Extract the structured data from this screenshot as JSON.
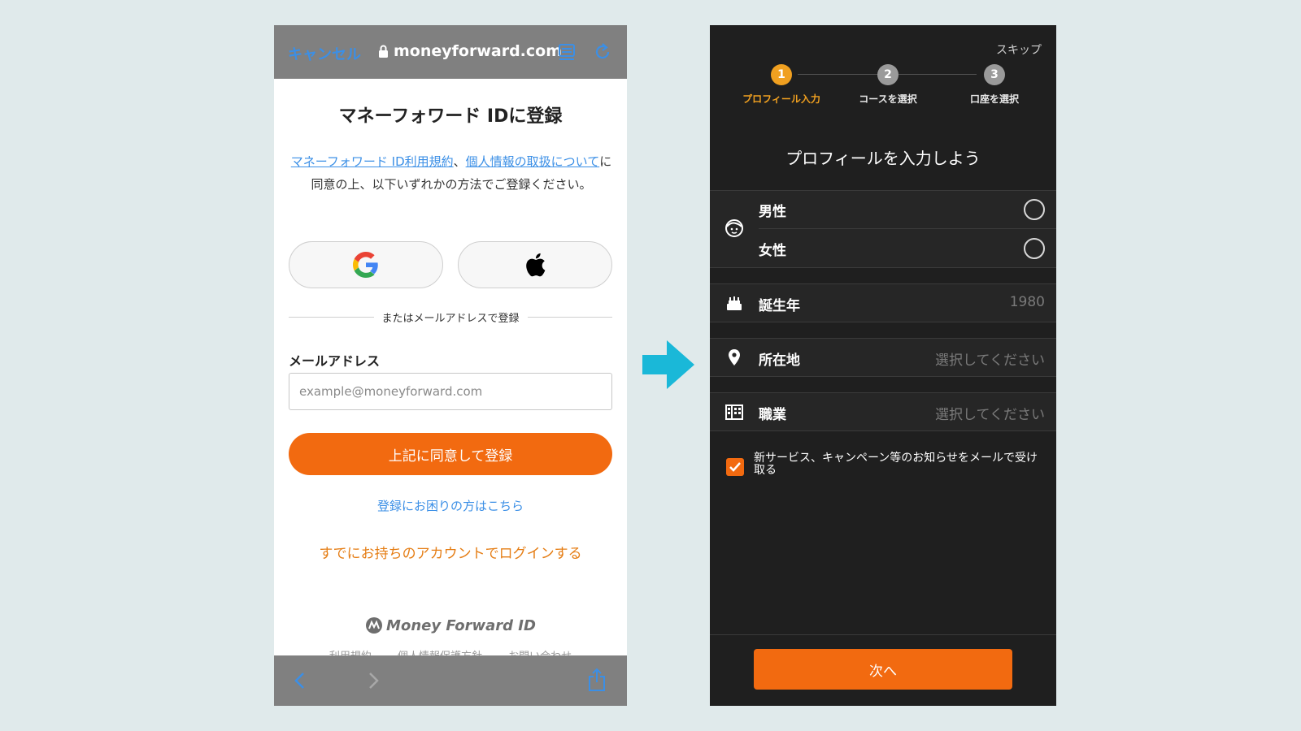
{
  "left": {
    "browser": {
      "cancel_label": "キャンセル",
      "url": "moneyforward.com"
    },
    "title": "マネーフォワード IDに登録",
    "terms": {
      "link1": "マネーフォワード ID利用規約",
      "separator": "、",
      "link2": "個人情報の取扱について",
      "suffix": "に同意の上、以下いずれかの方法でご登録ください。"
    },
    "divider_text": "またはメールアドレスで登録",
    "email": {
      "label": "メールアドレス",
      "placeholder": "example@moneyforward.com"
    },
    "register_button": "上記に同意して登録",
    "help_link": "登録にお困りの方はこちら",
    "login_link": "すでにお持ちのアカウントでログインする",
    "logo_text": "Money Forward ID",
    "footer_links": [
      "利用規約",
      "個人情報保護方針",
      "お問い合わせ"
    ]
  },
  "right": {
    "skip_label": "スキップ",
    "steps": [
      {
        "num": "1",
        "label": "プロフィール入力",
        "active": true
      },
      {
        "num": "2",
        "label": "コースを選択",
        "active": false
      },
      {
        "num": "3",
        "label": "口座を選択",
        "active": false
      }
    ],
    "title": "プロフィールを入力しよう",
    "gender": {
      "male": "男性",
      "female": "女性"
    },
    "birth_year": {
      "label": "誕生年",
      "value": "1980"
    },
    "location": {
      "label": "所在地",
      "value": "選択してください"
    },
    "occupation": {
      "label": "職業",
      "value": "選択してください"
    },
    "notify_text": "新サービス、キャンペーン等のお知らせをメールで受け取る",
    "next_button": "次へ"
  },
  "colors": {
    "accent_orange": "#f26a10",
    "step_active": "#f0a020",
    "link_blue": "#3b8fe6",
    "arrow_cyan": "#1ab8d8"
  }
}
